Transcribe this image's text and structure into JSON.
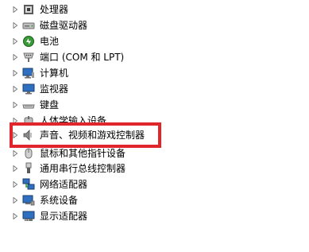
{
  "device_tree": {
    "items": [
      {
        "label": "处理器",
        "icon": "processor-icon"
      },
      {
        "label": "磁盘驱动器",
        "icon": "disk-drive-icon"
      },
      {
        "label": "电池",
        "icon": "battery-icon"
      },
      {
        "label": "端口 (COM 和 LPT)",
        "icon": "port-icon"
      },
      {
        "label": "计算机",
        "icon": "computer-icon"
      },
      {
        "label": "监视器",
        "icon": "monitor-icon"
      },
      {
        "label": "键盘",
        "icon": "keyboard-icon"
      },
      {
        "label": "人体学输入设备",
        "icon": "hid-icon"
      },
      {
        "label": "声音、视频和游戏控制器",
        "icon": "speaker-icon"
      },
      {
        "label": "鼠标和其他指针设备",
        "icon": "mouse-icon"
      },
      {
        "label": "通用串行总线控制器",
        "icon": "usb-icon"
      },
      {
        "label": "网络适配器",
        "icon": "network-adapter-icon"
      },
      {
        "label": "系统设备",
        "icon": "system-device-icon"
      },
      {
        "label": "显示适配器",
        "icon": "display-adapter-icon"
      }
    ]
  },
  "highlight": {
    "color": "#e0262a",
    "target_label_ref": "声音、视频和游戏控制器"
  }
}
